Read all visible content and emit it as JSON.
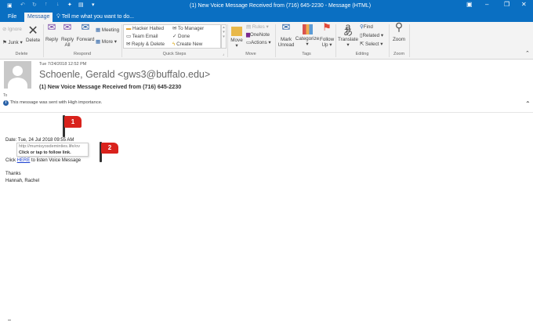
{
  "window": {
    "title": "(1) New Voice Message Received from (716) 645-2230 - Message (HTML)"
  },
  "tabs": [
    {
      "label": "File"
    },
    {
      "label": "Message"
    },
    {
      "label": "Tell me what you want to do..."
    }
  ],
  "ribbon": {
    "delete": {
      "label": "Delete",
      "ignore": "Ignore",
      "junk": "Junk",
      "delete": "Delete"
    },
    "respond": {
      "label": "Respond",
      "reply": "Reply",
      "reply_all": "Reply All",
      "forward": "Forward",
      "meeting": "Meeting",
      "more": "More"
    },
    "quick_steps": {
      "label": "Quick Steps",
      "items": [
        "Hacker Halted",
        "Team Email",
        "Reply & Delete",
        "To Manager",
        "Done",
        "Create New"
      ]
    },
    "move": {
      "label": "Move",
      "move": "Move",
      "rules": "Rules",
      "onenote": "OneNote",
      "actions": "Actions"
    },
    "tags": {
      "label": "Tags",
      "mark_unread": "Mark Unread",
      "categorize": "Categorize",
      "follow_up": "Follow Up"
    },
    "editing": {
      "label": "Editing",
      "translate": "Translate",
      "find": "Find",
      "related": "Related",
      "select": "Select"
    },
    "zoom": {
      "label": "Zoom",
      "zoom": "Zoom"
    }
  },
  "message": {
    "datetime": "Tue 7/24/2018 12:52 PM",
    "sender": "Schoenle, Gerald <gws3@buffalo.edu>",
    "subject": "(1) New Voice Message Received from (716) 645-2230",
    "to_label": "To",
    "importance": "This message was sent with High importance.",
    "body": {
      "date_line": "Date: Tue, 24 Jul 2018 09:55 AM",
      "click_pre": "Click ",
      "link": "HERE",
      "click_post": " to listen Voice Message",
      "thanks": "Thanks",
      "signature": "Hannah, Rachel"
    },
    "tooltip": {
      "url": "http://mumisyosdeminties.life/ov",
      "hint": "Click or tap to follow link."
    }
  },
  "annotations": [
    {
      "label": "1"
    },
    {
      "label": "2"
    }
  ]
}
